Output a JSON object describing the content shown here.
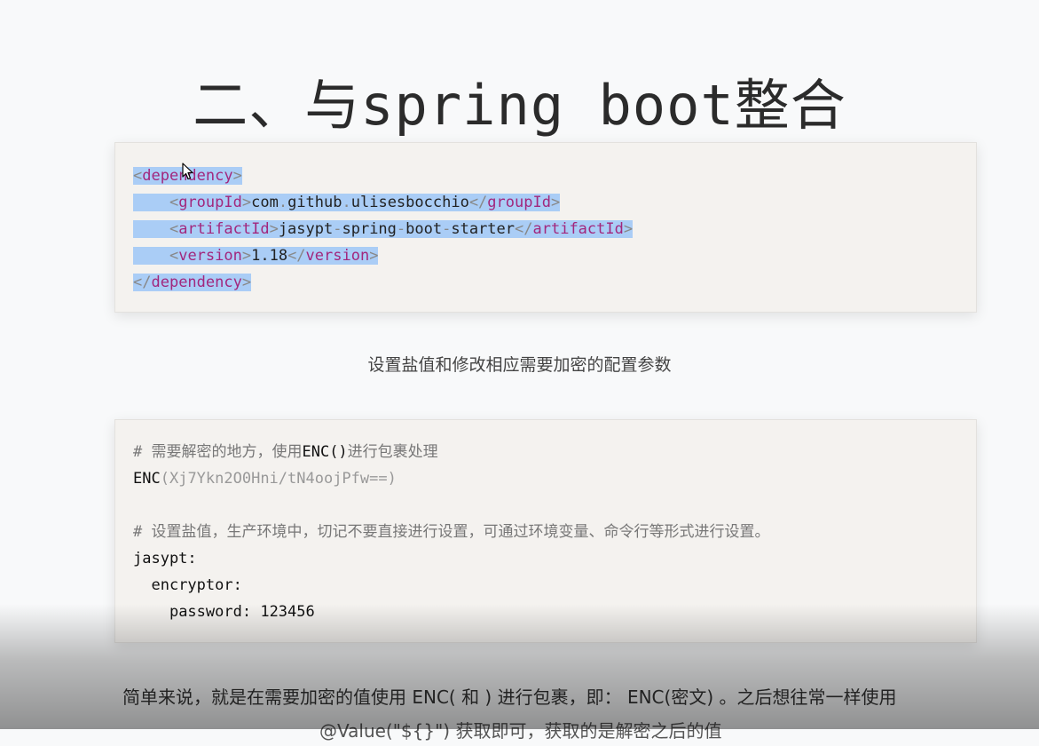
{
  "title": "二、与spring boot整合",
  "dependency_block": {
    "tag_dependency": "dependency",
    "tag_groupId": "groupId",
    "groupId_parts": [
      "com",
      "github",
      "ulisesbocchio"
    ],
    "tag_artifactId": "artifactId",
    "artifactId_parts": [
      "jasypt",
      "spring",
      "boot",
      "starter"
    ],
    "tag_version": "version",
    "version": "1.18"
  },
  "caption": "设置盐值和修改相应需要加密的配置参数",
  "config_block": {
    "comment1_text": "需要解密的地方，使用",
    "comment1_code": "ENC()",
    "comment1_tail": "进行包裹处理",
    "enc_func": "ENC",
    "enc_value": "Xj7Ykn2O0Hni/tN4oojPfw==",
    "comment2_text": "设置盐值，生产环境中，切记不要直接进行设置，可通过环境变量、命令行等形式进行设置。",
    "key_jasypt": "jasypt:",
    "key_encryptor": "encryptor:",
    "key_password": "password:",
    "password_value": "123456"
  },
  "paragraph_line1": "简单来说，就是在需要加密的值使用 ENC( 和 ) 进行包裹，即： ENC(密文) 。之后想往常一样使用",
  "paragraph_line2": "@Value(\"${}\") 获取即可，获取的是解密之后的值",
  "colors": {
    "tag": "#a2277d",
    "selection": "#aacdf6",
    "code_bg": "#f4f2ef"
  }
}
